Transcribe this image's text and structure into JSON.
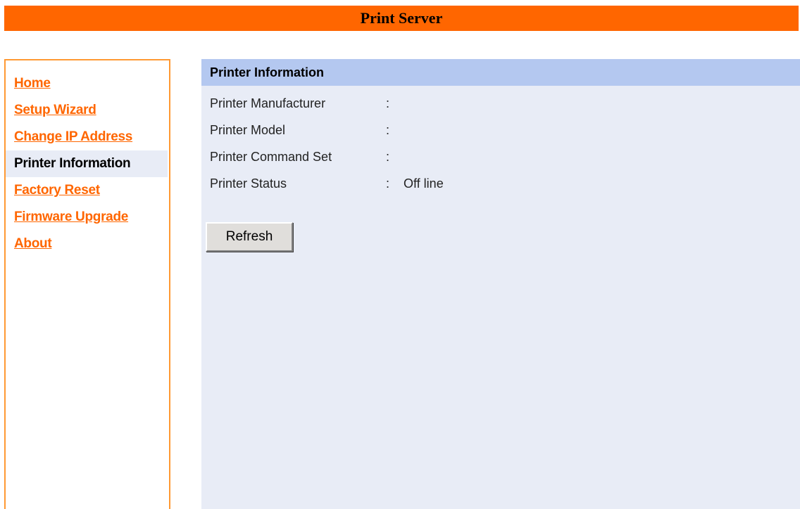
{
  "header": {
    "title": "Print Server"
  },
  "sidebar": {
    "items": [
      {
        "label": "Home"
      },
      {
        "label": "Setup Wizard"
      },
      {
        "label": "Change IP Address"
      },
      {
        "label": "Printer Information"
      },
      {
        "label": "Factory Reset"
      },
      {
        "label": "Firmware Upgrade"
      },
      {
        "label": "About"
      }
    ],
    "active_item": "Printer Information"
  },
  "main": {
    "section_title": "Printer Information",
    "fields": [
      {
        "label": "Printer Manufacturer",
        "separator": ":",
        "value": ""
      },
      {
        "label": "Printer Model",
        "separator": ":",
        "value": ""
      },
      {
        "label": "Printer Command Set",
        "separator": ":",
        "value": ""
      },
      {
        "label": "Printer Status",
        "separator": ":",
        "value": "Off line"
      }
    ],
    "refresh_label": "Refresh"
  },
  "colors": {
    "header_bg": "#ff6600",
    "link": "#ff6600",
    "section_header_bg": "#b4c8f0",
    "content_bg": "#e8ecf6"
  }
}
